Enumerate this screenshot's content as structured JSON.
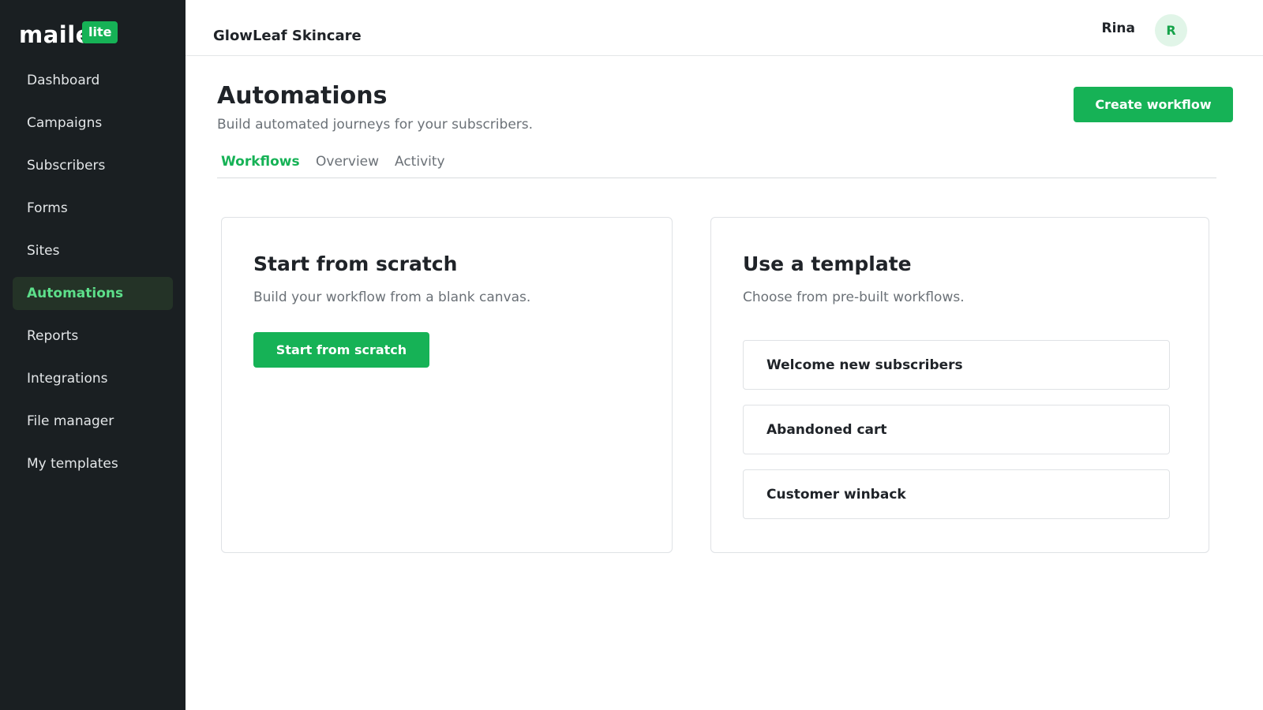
{
  "brand": {
    "logo_text": "maile",
    "logo_badge": "lite",
    "accent": "#16b256"
  },
  "sidebar": {
    "items": [
      {
        "label": "Dashboard"
      },
      {
        "label": "Campaigns"
      },
      {
        "label": "Subscribers"
      },
      {
        "label": "Forms"
      },
      {
        "label": "Sites"
      },
      {
        "label": "Automations",
        "active": true
      },
      {
        "label": "Reports"
      },
      {
        "label": "Integrations"
      },
      {
        "label": "File manager"
      },
      {
        "label": "My templates"
      }
    ]
  },
  "header": {
    "account_name": "GlowLeaf Skincare",
    "user_name": "Rina",
    "avatar_initial": "R"
  },
  "main": {
    "title": "Automations",
    "subtitle": "Build automated journeys for your subscribers.",
    "create_label": "Create workflow",
    "tabs": [
      {
        "label": "Workflows",
        "active": true
      },
      {
        "label": "Overview"
      },
      {
        "label": "Activity"
      }
    ]
  },
  "scratch_card": {
    "title": "Start from scratch",
    "description": "Build your workflow from a blank canvas.",
    "button_label": "Start from scratch"
  },
  "template_card": {
    "title": "Use a template",
    "description": "Choose from pre-built workflows.",
    "templates": [
      {
        "label": "Welcome new subscribers"
      },
      {
        "label": "Abandoned cart"
      },
      {
        "label": "Customer winback"
      }
    ]
  }
}
